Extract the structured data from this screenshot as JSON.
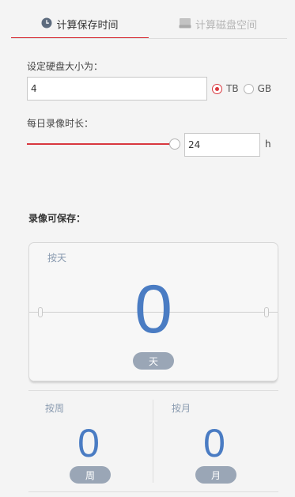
{
  "tabs": [
    {
      "label": "计算保存时间",
      "icon": "clock-icon",
      "active": true
    },
    {
      "label": "计算磁盘空间",
      "icon": "disk-icon",
      "active": false
    }
  ],
  "disk": {
    "label": "设定硬盘大小为：",
    "value": "4",
    "units": [
      {
        "label": "TB",
        "selected": true
      },
      {
        "label": "GB",
        "selected": false
      }
    ]
  },
  "daily": {
    "label": "每日录像时长：",
    "value": "24",
    "unit": "h",
    "slider_fraction": 1.0
  },
  "result": {
    "title": "录像可保存：",
    "day": {
      "label": "按天",
      "value": "0",
      "unit": "天"
    },
    "week": {
      "label": "按周",
      "value": "0",
      "unit": "周"
    },
    "month": {
      "label": "按月",
      "value": "0",
      "unit": "月"
    }
  },
  "colors": {
    "accent": "#d9383f",
    "number": "#4a7cc3",
    "pill": "#9aa6b6",
    "muted_label": "#8a9bb0"
  }
}
